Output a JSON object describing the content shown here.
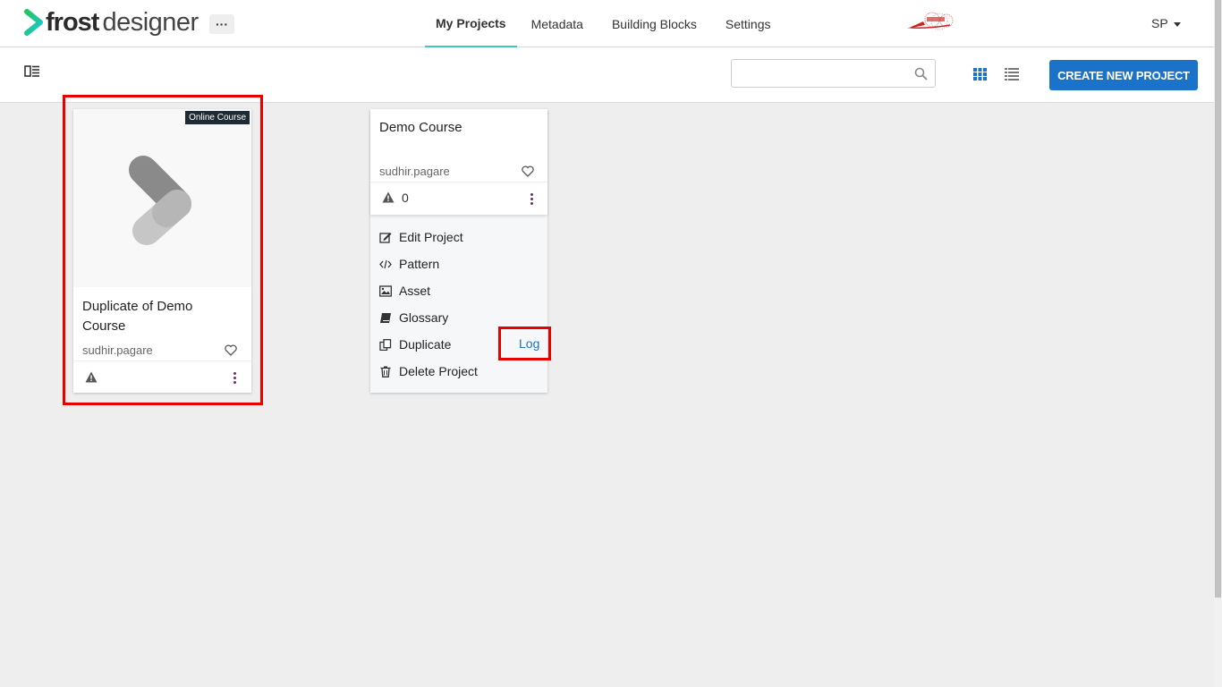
{
  "logo": {
    "part1": "frost",
    "part2": "designer"
  },
  "header": {
    "more_label": "···",
    "nav": [
      {
        "label": "My Projects",
        "active": true
      },
      {
        "label": "Metadata"
      },
      {
        "label": "Building Blocks"
      },
      {
        "label": "Settings"
      }
    ],
    "user_initials": "SP"
  },
  "toolbar": {
    "search_value": "",
    "create_label": "CREATE NEW PROJECT"
  },
  "projects": [
    {
      "title": "Duplicate of Demo Course",
      "badge": "Online Course",
      "author": "sudhir.pagare",
      "warnings": ""
    },
    {
      "title": "Demo Course",
      "author": "sudhir.pagare",
      "warnings": "0",
      "menu": [
        {
          "label": "Edit Project",
          "icon": "edit-icon"
        },
        {
          "label": "Pattern",
          "icon": "code-icon"
        },
        {
          "label": "Asset",
          "icon": "image-icon"
        },
        {
          "label": "Glossary",
          "icon": "book-icon"
        },
        {
          "label": "Duplicate",
          "icon": "copy-icon"
        },
        {
          "label": "Delete Project",
          "icon": "trash-icon"
        }
      ],
      "log_label": "Log"
    }
  ],
  "colors": {
    "accent": "#3dc8c3",
    "primary": "#1a73c8",
    "highlight": "#e60000",
    "kebab": "#6b2d6b"
  }
}
